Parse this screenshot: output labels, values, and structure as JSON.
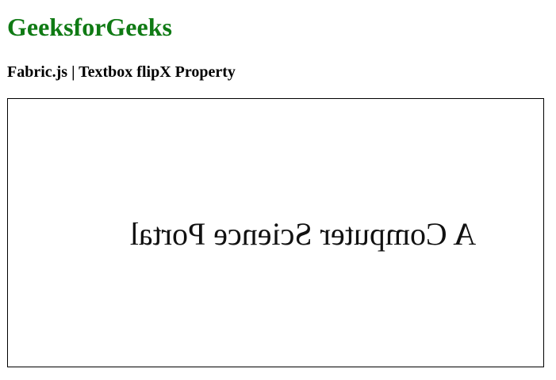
{
  "header": {
    "site_title": "GeeksforGeeks",
    "subtitle": "Fabric.js | Textbox flipX Property"
  },
  "canvas": {
    "textbox": {
      "text": "A Computer Science Portal",
      "flipX": true
    }
  },
  "colors": {
    "brand": "#0f7a14",
    "text": "#000000",
    "canvas_border": "#000000"
  }
}
